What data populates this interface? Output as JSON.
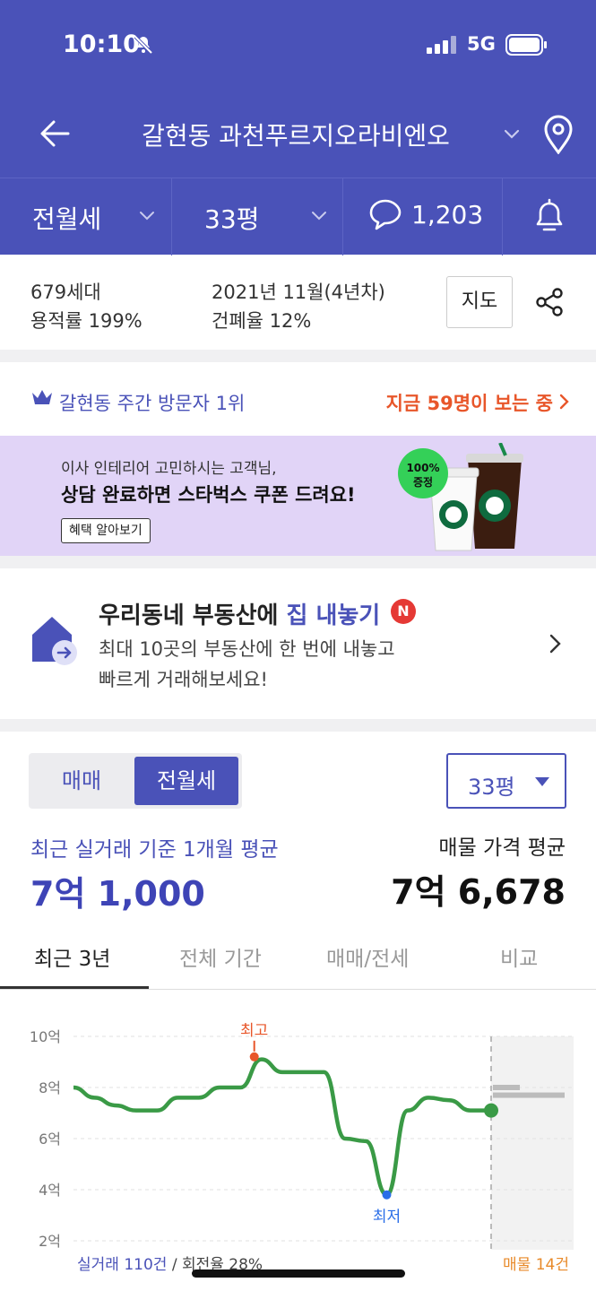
{
  "status": {
    "time": "10:10",
    "network": "5G"
  },
  "nav": {
    "title": "갈현동 과천푸르지오라비엔오"
  },
  "tabs": {
    "deal_type": "전월세",
    "size": "33평",
    "comments": "1,203"
  },
  "info": {
    "households": "679세대",
    "far": "용적률 199%",
    "built": "2021년 11월(4년차)",
    "bcr": "건폐율 12%",
    "map_label": "지도"
  },
  "visitors": {
    "rank": "갈현동 주간 방문자 1위",
    "viewing": "지금 59명이 보는 중"
  },
  "banner": {
    "line1": "이사 인테리어 고민하시는 고객님,",
    "line2": "상담 완료하면 스타벅스 쿠폰 드려요!",
    "button": "혜택 알아보기",
    "badge": "100% 증정"
  },
  "sell": {
    "title_a": "우리동네 부동산에 ",
    "title_b": "집 내놓기",
    "badge": "N",
    "desc1": "최대 10곳의 부동산에 한 번에 내놓고",
    "desc2": "빠르게 거래해보세요!"
  },
  "price": {
    "seg_buy": "매매",
    "seg_rent": "전월세",
    "size": "33평",
    "recent_label": "최근 실거래 기준 1개월 평균",
    "recent_value": "7억 1,000",
    "ask_label": "매물 가격 평균",
    "ask_value": "7억 6,678"
  },
  "period_tabs": [
    "최근 3년",
    "전체 기간",
    "매매/전세",
    "비교"
  ],
  "chart_data": {
    "type": "line",
    "y_ticks": [
      "10억",
      "8억",
      "6억",
      "4억",
      "2억"
    ],
    "ylim": [
      2,
      10
    ],
    "yunit": "억",
    "series": [
      {
        "values": [
          8.0,
          7.6,
          7.3,
          7.1,
          7.1,
          7.6,
          7.6,
          8.0,
          8.0,
          9.1,
          8.6,
          8.6,
          8.6,
          6.0,
          5.9,
          3.8,
          7.1,
          7.6,
          7.5,
          7.1,
          7.1
        ]
      }
    ],
    "annotations": [
      {
        "label": "최고",
        "value": 9.2
      },
      {
        "label": "최저",
        "value": 3.8
      }
    ],
    "footer_left_a": "실거래 110건",
    "footer_left_b": " / 회전율 28%",
    "footer_right": "매물 14건",
    "colors": {
      "line": "#3a9a46",
      "max": "#e8562a",
      "min": "#2a6ee8",
      "accent": "#4a52b8"
    }
  }
}
